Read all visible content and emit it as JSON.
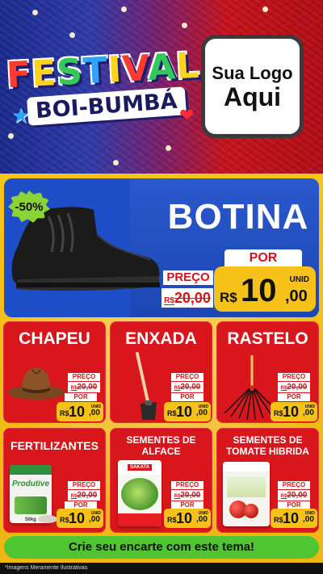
{
  "header": {
    "festival_title": "FESTIVAL",
    "festival_subtitle": "BOI-BUMBÁ",
    "logo_line1": "Sua Logo",
    "logo_line2": "Aqui"
  },
  "featured": {
    "discount_badge": "-50%",
    "name": "BOTINA",
    "preco_label": "PREÇO",
    "old_price_currency": "R$",
    "old_price_int": "20",
    "old_price_dec": ",00",
    "por_label": "POR",
    "currency": "R$",
    "price_int": "10",
    "price_dec": ",00",
    "unit": "UNID"
  },
  "products": [
    {
      "name": "CHAPEU",
      "preco_label": "PREÇO",
      "old_price_currency": "R$",
      "old_price_int": "20",
      "old_price_dec": ",00",
      "por_label": "POR",
      "currency": "R$",
      "price_int": "10",
      "price_dec": ",00",
      "unit": "UNID"
    },
    {
      "name": "ENXADA",
      "preco_label": "PREÇO",
      "old_price_currency": "R$",
      "old_price_int": "20",
      "old_price_dec": ",00",
      "por_label": "POR",
      "currency": "R$",
      "price_int": "10",
      "price_dec": ",00",
      "unit": "UNID"
    },
    {
      "name": "RASTELO",
      "preco_label": "PREÇO",
      "old_price_currency": "R$",
      "old_price_int": "20",
      "old_price_dec": ",00",
      "por_label": "POR",
      "currency": "R$",
      "price_int": "10",
      "price_dec": ",00",
      "unit": "UNID"
    },
    {
      "name": "FERTILIZANTES",
      "bag_text": "Produtive",
      "bag_weight": "50kg",
      "preco_label": "PREÇO",
      "old_price_currency": "R$",
      "old_price_int": "20",
      "old_price_dec": ",00",
      "por_label": "POR",
      "currency": "R$",
      "price_int": "10",
      "price_dec": ",00",
      "unit": "UNID"
    },
    {
      "name_line1": "SEMENTES DE",
      "name_line2": "ALFACE",
      "bag_text": "SAKATA",
      "preco_label": "PREÇO",
      "old_price_currency": "R$",
      "old_price_int": "20",
      "old_price_dec": ",00",
      "por_label": "POR",
      "currency": "R$",
      "price_int": "10",
      "price_dec": ",00",
      "unit": "UNID"
    },
    {
      "name_line1": "SEMENTES DE",
      "name_line2": "TOMATE HIBRIDA",
      "preco_label": "PREÇO",
      "old_price_currency": "R$",
      "old_price_int": "20",
      "old_price_dec": ",00",
      "por_label": "POR",
      "currency": "R$",
      "price_int": "10",
      "price_dec": ",00",
      "unit": "UNID"
    }
  ],
  "cta": "Crie seu encarte com este tema!",
  "footnote": "*Imagens Meramente Ilustrativas",
  "colors": {
    "card_red": "#d8161c",
    "price_yellow": "#f6c21a",
    "featured_blue": "#1f4fc8",
    "cta_green": "#4fc631",
    "background_yellow": "#f5c518"
  }
}
